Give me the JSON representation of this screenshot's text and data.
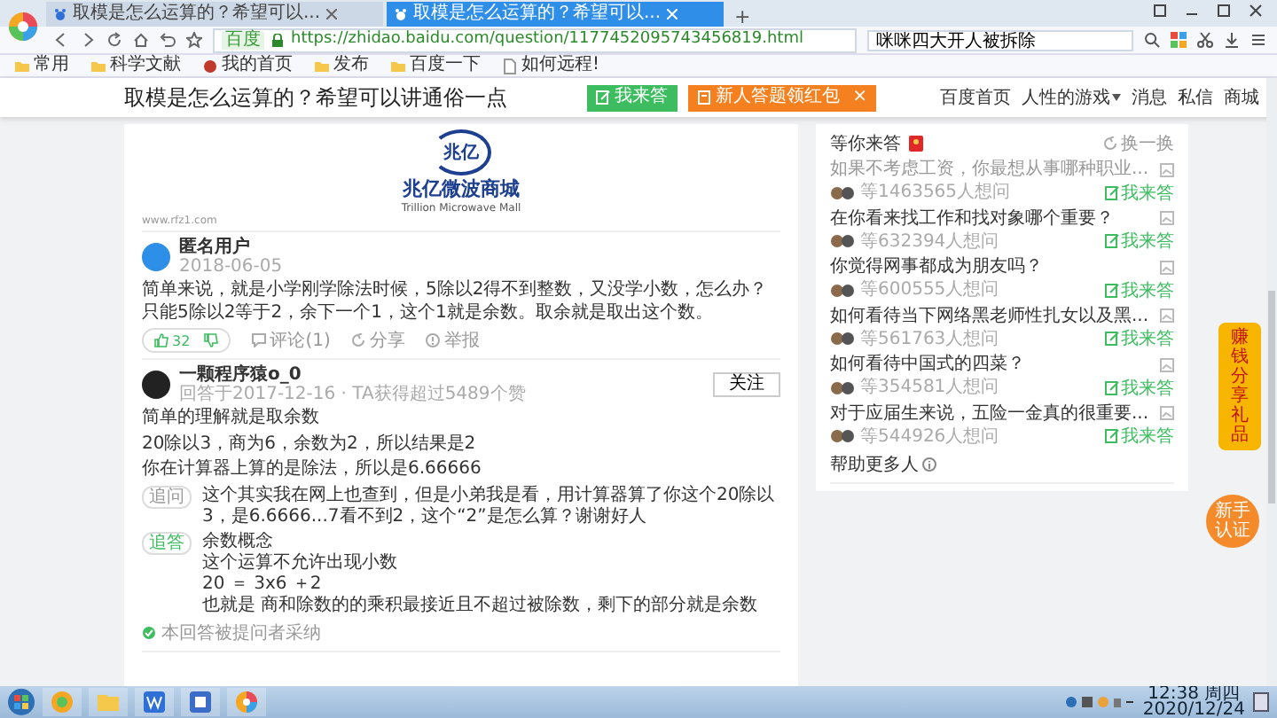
{
  "browser": {
    "tabs": [
      {
        "title": "取模是怎么运算的？希望可以...",
        "selected": false
      },
      {
        "title": "取模是怎么运算的？希望可以...",
        "selected": true
      }
    ],
    "new_tab": "+",
    "address": {
      "site_badge": "百度",
      "url": "https://zhidao.baidu.com/question/1177452095743456819.html"
    },
    "search": {
      "value": "咪咪四大开人被拆除"
    },
    "bookmarks": [
      {
        "label": "常用",
        "kind": "folder"
      },
      {
        "label": "科学文献",
        "kind": "folder"
      },
      {
        "label": "我的首页",
        "kind": "site"
      },
      {
        "label": "发布",
        "kind": "folder"
      },
      {
        "label": "百度一下",
        "kind": "folder"
      },
      {
        "label": "如何远程!",
        "kind": "page"
      }
    ]
  },
  "page_header": {
    "title": "取模是怎么运算的？希望可以讲通俗一点",
    "buttons": [
      {
        "label": "我来答",
        "kind": "answer"
      },
      {
        "label": "新人答题领红包",
        "kind": "promo",
        "close": "×"
      }
    ],
    "nav": [
      {
        "label": "百度首页",
        "has_menu": false
      },
      {
        "label": "人性的游戏",
        "has_menu": true
      },
      {
        "label": "消息",
        "has_menu": false
      },
      {
        "label": "私信",
        "has_menu": false
      },
      {
        "label": "商城",
        "has_menu": false
      }
    ]
  },
  "ad": {
    "logo_text": "兆亿",
    "name": "兆亿微波商城",
    "english_name": "Trillion Microwave Mall",
    "site": "www.rfz1.com"
  },
  "answers": [
    {
      "user": "匿名用户",
      "meta": "2018-06-05",
      "paragraphs": [
        "简单来说，就是小学刚学除法时候，5除以2得不到整数，又没学小数，怎么办？只能5除以2等于2，余下一个1，这个1就是余数。取余就是取出这个数。"
      ],
      "actions": {
        "likes": "32",
        "comment": "评论(1)",
        "share": "分享",
        "report": "举报"
      }
    },
    {
      "user": "一颗程序猿o_0",
      "meta": "回答于2017-12-16 · TA获得超过5489个赞",
      "follow": "关注",
      "paragraphs": [
        "简单的理解就是取余数",
        "20除以3，商为6，余数为2，所以结果是2",
        "你在计算器上算的是除法，所以是6.66666"
      ],
      "thread": [
        {
          "tag": "追问",
          "lines": [
            "这个其实我在网上也查到，但是小弟我是看，用计算器算了你这个20除以3，是6.6666...7看不到2，这个“2”是怎么算？谢谢好人"
          ]
        },
        {
          "tag": "追答",
          "lines": [
            "余数概念",
            "这个运算不允许出现小数",
            "20 ＝ 3x6 ＋2",
            "也就是 商和除数的的乘积最接近且不超过被除数，剩下的部分就是余数"
          ]
        }
      ],
      "adopted": "本回答被提问者采纳"
    }
  ],
  "sidebar": {
    "title": "等你来答",
    "refresh": "换一换",
    "items": [
      {
        "question": "如果不考虑工资，你最想从事哪种职业...",
        "asked": "等1463565人想问",
        "answer": "我来答",
        "visited": true
      },
      {
        "question": "在你看来找工作和找对象哪个重要？",
        "asked": "等632394人想问",
        "answer": "我来答",
        "visited": false
      },
      {
        "question": "你觉得网事都成为朋友吗？",
        "asked": "等600555人想问",
        "answer": "我来答",
        "visited": false
      },
      {
        "question": "如何看待当下网络黑老师性扎女以及黑...",
        "asked": "等561763人想问",
        "answer": "我来答",
        "visited": false
      },
      {
        "question": "如何看待中国式的四菜？",
        "asked": "等354581人想问",
        "answer": "我来答",
        "visited": false
      },
      {
        "question": "对于应届生来说，五险一金真的很重要...",
        "asked": "等544926人想问",
        "answer": "我来答",
        "visited": false
      }
    ],
    "help": "帮助更多人"
  },
  "floating": {
    "promo": "赚钱分享礼品",
    "badge": "新手认证"
  },
  "taskbar": {
    "time": "12:38 周四",
    "date": "2020/12/24"
  }
}
